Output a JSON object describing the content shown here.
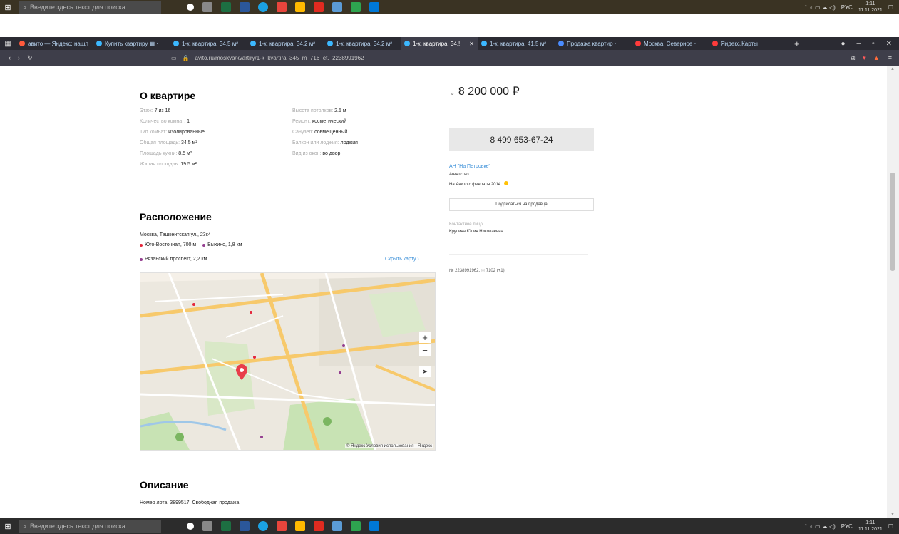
{
  "taskbar": {
    "search_placeholder": "Введите здесь текст для поиска",
    "time": "1:11",
    "date": "11.11.2021",
    "lang": "РУС"
  },
  "browser": {
    "tabs": [
      {
        "label": "авито — Яндекс: нашл",
        "color": "#ff5a3c"
      },
      {
        "label": "Купить квартиру ▦ ·",
        "color": "#3cb8ff"
      },
      {
        "label": "1-к. квартира, 34,5 м²",
        "color": "#3cb8ff"
      },
      {
        "label": "1-к. квартира, 34,2 м²",
        "color": "#3cb8ff"
      },
      {
        "label": "1-к. квартира, 34,2 м²",
        "color": "#3cb8ff"
      },
      {
        "label": "1-к. квартира, 34,!",
        "color": "#3cb8ff",
        "active": true
      },
      {
        "label": "1-к. квартира, 41,5 м²",
        "color": "#3cb8ff"
      },
      {
        "label": "Продажа квартир ·",
        "color": "#4a8cff"
      },
      {
        "label": "Москва: Северное ·",
        "color": "#ff3b3b"
      },
      {
        "label": "Яндекс.Карты",
        "color": "#ff3b3b"
      }
    ],
    "url": "avito.ru/moskva/kvartiry/1-k_kvartira_345_m_716_et._2238991962"
  },
  "about": {
    "heading": "О квартире",
    "left": [
      {
        "label": "Этаж:",
        "value": "7 из 16"
      },
      {
        "label": "Количество комнат:",
        "value": "1"
      },
      {
        "label": "Тип комнат:",
        "value": "изолированные"
      },
      {
        "label": "Общая площадь:",
        "value": "34.5 м²"
      },
      {
        "label": "Площадь кухни:",
        "value": "8.5 м²"
      },
      {
        "label": "Жилая площадь:",
        "value": "19.5 м²"
      }
    ],
    "right": [
      {
        "label": "Высота потолков:",
        "value": "2.5 м"
      },
      {
        "label": "Ремонт:",
        "value": "косметический"
      },
      {
        "label": "Санузел:",
        "value": "совмещенный"
      },
      {
        "label": "Балкон или лоджия:",
        "value": "лоджия"
      },
      {
        "label": "Вид из окон:",
        "value": "во двор"
      }
    ]
  },
  "location": {
    "heading": "Расположение",
    "address": "Москва, Ташкентская ул., 23к4",
    "metro": [
      {
        "name": "Юго-Восточная, 700 м",
        "color": "#e4263b"
      },
      {
        "name": "Выхино, 1,8 км",
        "color": "#943e90"
      },
      {
        "name": "Рязанский проспект, 2,2 км",
        "color": "#943e90"
      }
    ],
    "hide_map": "Скрыть карту ›",
    "map_attr": "© Яндекс Условия использования · Яндекс"
  },
  "description": {
    "heading": "Описание",
    "text": "Номер лота: 3899517. Свободная продажа."
  },
  "sidebar": {
    "price": "8 200 000 ₽",
    "phone": "8 499 653-67-24",
    "agency": "АН \"На Петровке\"",
    "agency_type": "Агентство",
    "since": "На Авито с февраля 2014",
    "subscribe": "Подписаться на продавца",
    "contact_label": "Контактное лицо",
    "contact_name": "Крупина Юлия Николаевна",
    "ad_number": "№ 2238991962",
    "views": "7102 (+1)"
  }
}
